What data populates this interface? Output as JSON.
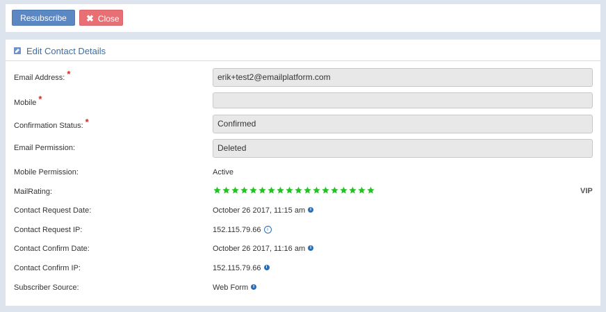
{
  "toolbar": {
    "resubscribe_label": "Resubscribe",
    "close_label": "Close",
    "close_icon": "close-x-icon",
    "resubscribe_color": "#5b87c2",
    "close_color": "#e86f73"
  },
  "panel": {
    "title": "Edit Contact Details",
    "title_icon": "edit-icon"
  },
  "fields": {
    "email_address": {
      "label": "Email Address:",
      "required": "*",
      "value": "erik+test2@emailplatform.com"
    },
    "mobile": {
      "label": "Mobile",
      "required": "*",
      "value": ""
    },
    "confirmation_status": {
      "label": "Confirmation Status:",
      "required": "*",
      "value": "Confirmed"
    },
    "email_permission": {
      "label": "Email Permission:",
      "value": "Deleted"
    },
    "mobile_permission": {
      "label": "Mobile Permission:",
      "value": "Active"
    },
    "mail_rating": {
      "label": "MailRating:",
      "stars": 18,
      "badge": "VIP",
      "star_color": "#22c322"
    },
    "contact_request_date": {
      "label": "Contact Request Date:",
      "value": "October 26 2017, 11:15 am"
    },
    "contact_request_ip": {
      "label": "Contact Request IP:",
      "value": "152.115.79.66"
    },
    "contact_confirm_date": {
      "label": "Contact Confirm Date:",
      "value": "October 26 2017, 11:16 am"
    },
    "contact_confirm_ip": {
      "label": "Contact Confirm IP:",
      "value": "152.115.79.66"
    },
    "subscriber_source": {
      "label": "Subscriber Source:",
      "value": "Web Form"
    }
  },
  "colors": {
    "accent": "#3b6ea5",
    "required": "#d9261c",
    "info": "#2c6db2"
  }
}
